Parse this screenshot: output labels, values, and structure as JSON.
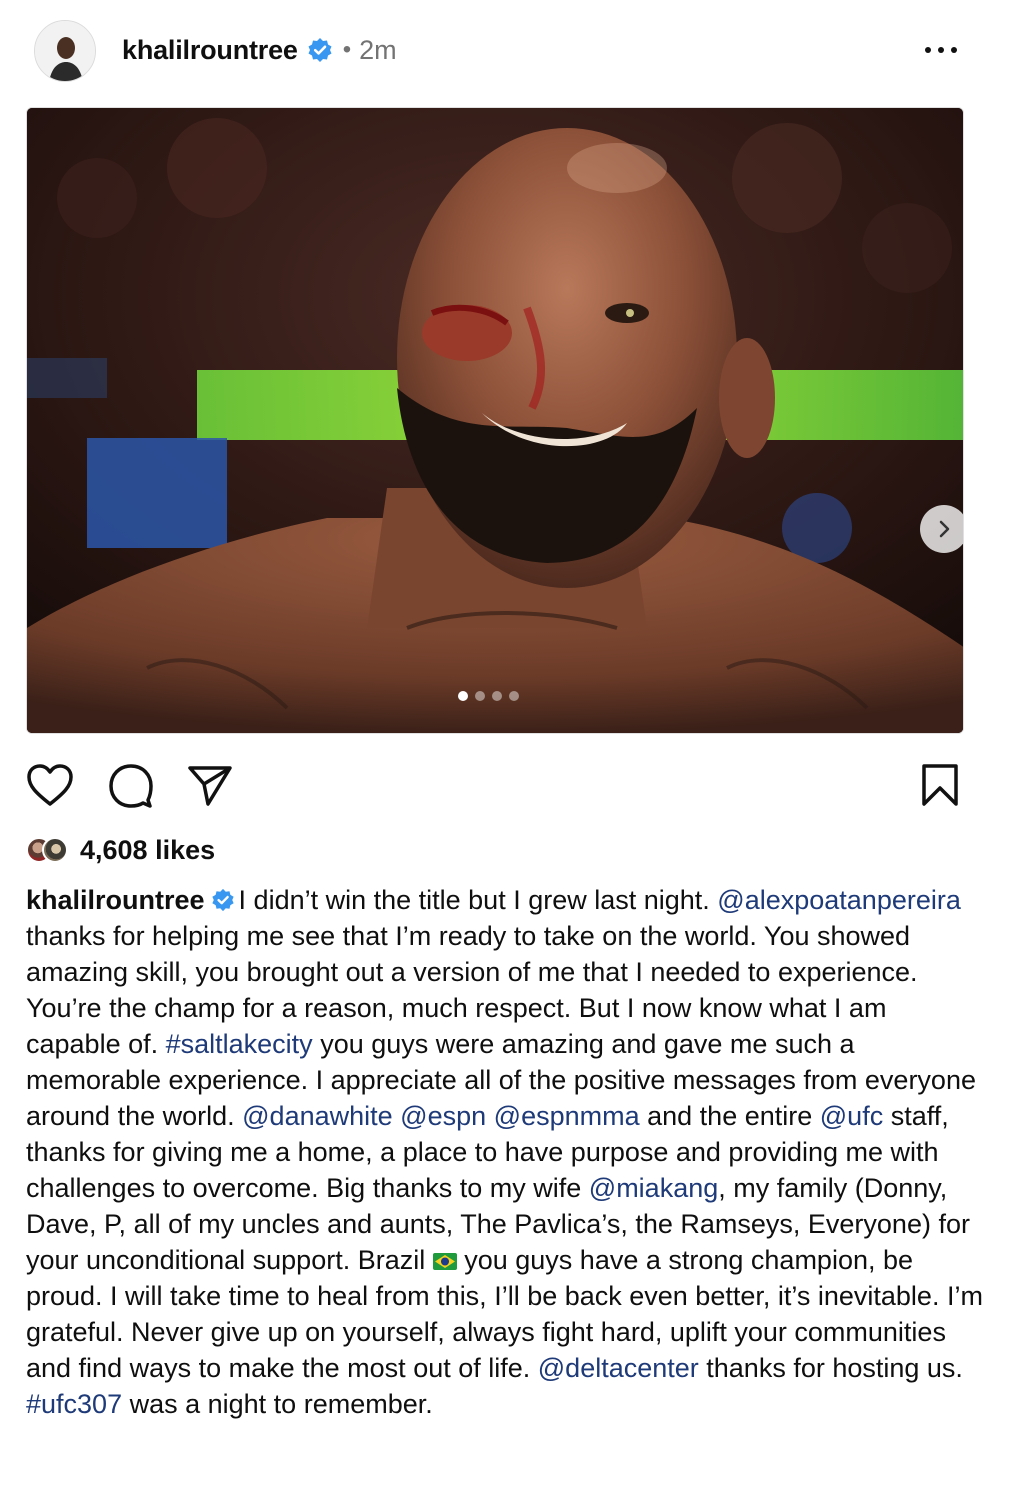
{
  "post": {
    "username": "khalilrountree",
    "separator": "•",
    "time": "2m",
    "more_label": "more-options",
    "verified_color": "#3897f0"
  },
  "media": {
    "carousel_count": 4,
    "active_index": 0,
    "next_icon": "chevron-right-icon"
  },
  "actions": {
    "like_icon": "heart-icon",
    "comment_icon": "comment-icon",
    "share_icon": "share-icon",
    "save_icon": "bookmark-icon"
  },
  "likes": {
    "text": "4,608 likes"
  },
  "caption": {
    "username": "khalilrountree",
    "link_color": "#1e3a78",
    "segments": [
      {
        "t": "text",
        "v": "I didn’t win the title but I grew last night. "
      },
      {
        "t": "tag",
        "v": "@alexpoatanpereira"
      },
      {
        "t": "text",
        "v": " thanks for helping me see that I’m ready to take on the world. You showed amazing skill, you brought out a version of me that I needed to experience. You’re the champ for a reason, much respect. But I now know what I am capable of. "
      },
      {
        "t": "tag",
        "v": "#saltlakecity"
      },
      {
        "t": "text",
        "v": " you guys were amazing and gave me such a memorable experience. I appreciate all of the positive messages from everyone around the world. "
      },
      {
        "t": "tag",
        "v": "@danawhite"
      },
      {
        "t": "text",
        "v": " "
      },
      {
        "t": "tag",
        "v": "@espn"
      },
      {
        "t": "text",
        "v": " "
      },
      {
        "t": "tag",
        "v": "@espnmma"
      },
      {
        "t": "text",
        "v": " and the entire "
      },
      {
        "t": "tag",
        "v": "@ufc"
      },
      {
        "t": "text",
        "v": " staff, thanks for giving me a home, a place to have purpose and providing me with challenges to overcome. Big thanks to my wife "
      },
      {
        "t": "tag",
        "v": "@miakang"
      },
      {
        "t": "text",
        "v": ", my family (Donny, Dave, P, all of my uncles and aunts, The Pavlica’s, the Ramseys, Everyone) for your unconditional support. Brazil "
      },
      {
        "t": "flag",
        "v": "brazil-flag-icon"
      },
      {
        "t": "text",
        "v": " you guys have a strong champion, be proud. I will take time to heal from this, I’ll be back even better, it’s inevitable. I’m grateful. Never give up on yourself, always fight hard, uplift your communities and find ways to make the most out of life. "
      },
      {
        "t": "tag",
        "v": "@deltacenter"
      },
      {
        "t": "text",
        "v": " thanks for hosting us. "
      },
      {
        "t": "tag",
        "v": "#ufc307"
      },
      {
        "t": "text",
        "v": " was a night to remember."
      }
    ]
  }
}
